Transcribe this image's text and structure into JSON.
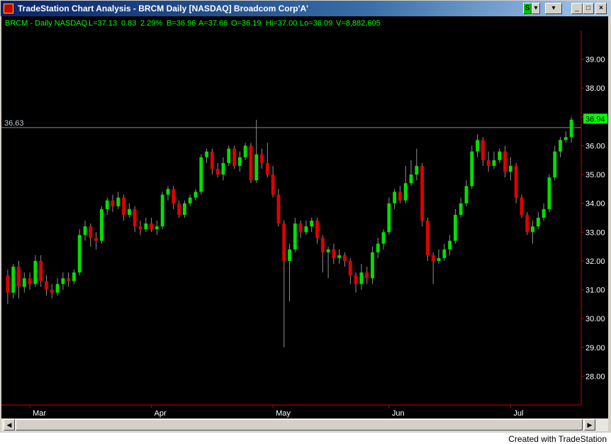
{
  "window": {
    "title": "TradeStation Chart Analysis - BRCM Daily [NASDAQ] Broadcom Corp'A'",
    "symbol_button": "S",
    "min_glyph": "_",
    "max_glyph": "□",
    "close_glyph": "×",
    "dropdown_glyph": "▾"
  },
  "status": {
    "symbol": "BRCM - Daily  NASDAQ",
    "last": "L=37.13",
    "change": "0.83",
    "pct": "2.29%",
    "bid": "B=36.96",
    "ask": "A=37.66",
    "open": "O=36.19",
    "high": "Hi=37.00",
    "low": "Lo=36.09",
    "volume": "V=8,882,605"
  },
  "colors": {
    "up": "#00e000",
    "down": "#e00000",
    "background": "#000000",
    "axis": "#cc0000",
    "status_text": "#00ff00",
    "hline": "#8090a0",
    "last_box": "#00ff00"
  },
  "scroll": {
    "left_arrow": "◀",
    "right_arrow": "▶"
  },
  "footer": "Created with TradeStation",
  "chart_data": {
    "type": "candlestick",
    "y_range": [
      27.0,
      40.0
    ],
    "y_ticks": [
      28.0,
      29.0,
      30.0,
      31.0,
      32.0,
      33.0,
      34.0,
      35.0,
      36.0,
      37.0,
      38.0,
      39.0
    ],
    "x_labels": [
      {
        "label": "Mar",
        "index": 4
      },
      {
        "label": "Apr",
        "index": 26
      },
      {
        "label": "May",
        "index": 48
      },
      {
        "label": "Jun",
        "index": 69
      },
      {
        "label": "Jul",
        "index": 91
      }
    ],
    "horizontal_line": 36.63,
    "last_price": 36.94,
    "candles": [
      [
        31.5,
        30.9,
        31.7,
        30.5
      ],
      [
        30.9,
        31.8,
        31.9,
        30.7
      ],
      [
        31.8,
        31.1,
        32.0,
        30.7
      ],
      [
        31.1,
        31.4,
        31.6,
        30.9
      ],
      [
        31.4,
        31.2,
        31.6,
        31.0
      ],
      [
        31.2,
        32.0,
        32.2,
        31.1
      ],
      [
        32.0,
        31.3,
        32.2,
        31.1
      ],
      [
        31.3,
        31.0,
        31.5,
        30.8
      ],
      [
        31.0,
        30.9,
        31.2,
        30.7
      ],
      [
        30.9,
        31.2,
        31.4,
        30.8
      ],
      [
        31.2,
        31.4,
        31.6,
        31.0
      ],
      [
        31.4,
        31.3,
        31.6,
        31.1
      ],
      [
        31.3,
        31.6,
        31.7,
        31.2
      ],
      [
        31.6,
        32.9,
        33.1,
        31.5
      ],
      [
        32.9,
        33.2,
        33.4,
        32.7
      ],
      [
        33.2,
        32.8,
        33.3,
        32.5
      ],
      [
        32.8,
        32.7,
        33.0,
        32.4
      ],
      [
        32.7,
        33.8,
        33.9,
        32.6
      ],
      [
        33.8,
        34.1,
        34.2,
        33.6
      ],
      [
        34.1,
        33.9,
        34.3,
        33.7
      ],
      [
        33.9,
        34.2,
        34.4,
        33.8
      ],
      [
        34.2,
        33.6,
        34.3,
        33.4
      ],
      [
        33.6,
        33.8,
        34.0,
        33.5
      ],
      [
        33.8,
        33.2,
        33.9,
        33.0
      ],
      [
        33.2,
        33.1,
        33.4,
        32.9
      ],
      [
        33.1,
        33.3,
        33.5,
        33.0
      ],
      [
        33.3,
        33.1,
        33.5,
        33.0
      ],
      [
        33.1,
        33.2,
        33.4,
        32.9
      ],
      [
        33.2,
        34.3,
        34.4,
        33.1
      ],
      [
        34.3,
        34.5,
        34.6,
        34.1
      ],
      [
        34.5,
        34.0,
        34.6,
        33.8
      ],
      [
        34.0,
        33.6,
        34.1,
        33.5
      ],
      [
        33.6,
        34.0,
        34.1,
        33.5
      ],
      [
        34.0,
        34.2,
        34.3,
        33.9
      ],
      [
        34.2,
        34.4,
        34.5,
        34.1
      ],
      [
        34.4,
        35.6,
        35.7,
        34.3
      ],
      [
        35.6,
        35.8,
        35.9,
        35.4
      ],
      [
        35.8,
        35.2,
        35.9,
        35.0
      ],
      [
        35.2,
        35.0,
        35.4,
        34.9
      ],
      [
        35.0,
        35.4,
        35.6,
        34.8
      ],
      [
        35.4,
        35.9,
        36.0,
        35.3
      ],
      [
        35.9,
        35.3,
        36.0,
        35.2
      ],
      [
        35.3,
        35.6,
        35.8,
        35.1
      ],
      [
        35.6,
        36.0,
        36.1,
        35.5
      ],
      [
        36.0,
        34.8,
        36.1,
        34.7
      ],
      [
        34.8,
        35.7,
        36.9,
        34.7
      ],
      [
        35.7,
        35.4,
        35.9,
        35.2
      ],
      [
        35.4,
        35.0,
        36.1,
        34.9
      ],
      [
        35.0,
        34.3,
        35.3,
        34.2
      ],
      [
        34.3,
        33.3,
        34.5,
        33.2
      ],
      [
        33.3,
        32.0,
        33.4,
        29.0
      ],
      [
        32.0,
        32.4,
        32.6,
        30.6
      ],
      [
        32.4,
        33.3,
        33.5,
        32.3
      ],
      [
        33.3,
        33.0,
        33.4,
        32.8
      ],
      [
        33.0,
        33.2,
        33.4,
        32.9
      ],
      [
        33.2,
        33.4,
        33.5,
        33.0
      ],
      [
        33.4,
        32.8,
        33.5,
        32.6
      ],
      [
        32.8,
        32.3,
        32.9,
        31.6
      ],
      [
        32.3,
        32.4,
        32.5,
        31.4
      ],
      [
        32.4,
        32.1,
        32.6,
        31.9
      ],
      [
        32.1,
        32.2,
        32.4,
        31.9
      ],
      [
        32.2,
        32.0,
        32.3,
        31.8
      ],
      [
        32.0,
        31.5,
        32.1,
        31.2
      ],
      [
        31.5,
        31.2,
        31.6,
        30.9
      ],
      [
        31.2,
        31.6,
        31.9,
        31.0
      ],
      [
        31.6,
        31.4,
        31.8,
        31.2
      ],
      [
        31.4,
        32.3,
        32.5,
        31.2
      ],
      [
        32.3,
        32.6,
        32.8,
        32.1
      ],
      [
        32.6,
        33.0,
        33.1,
        32.4
      ],
      [
        33.0,
        34.0,
        34.2,
        32.9
      ],
      [
        34.0,
        34.4,
        34.5,
        33.8
      ],
      [
        34.4,
        34.1,
        34.6,
        34.0
      ],
      [
        34.1,
        34.7,
        35.3,
        34.0
      ],
      [
        34.7,
        35.0,
        35.5,
        34.6
      ],
      [
        35.0,
        35.3,
        35.9,
        34.8
      ],
      [
        35.3,
        33.4,
        35.4,
        33.2
      ],
      [
        33.4,
        32.2,
        33.5,
        32.0
      ],
      [
        32.2,
        32.0,
        32.3,
        31.2
      ],
      [
        32.0,
        32.1,
        32.4,
        31.9
      ],
      [
        32.1,
        32.4,
        32.6,
        32.0
      ],
      [
        32.4,
        32.7,
        32.9,
        32.2
      ],
      [
        32.7,
        33.6,
        33.8,
        32.6
      ],
      [
        33.6,
        34.0,
        34.2,
        33.5
      ],
      [
        34.0,
        34.6,
        34.8,
        33.9
      ],
      [
        34.6,
        35.8,
        36.0,
        34.5
      ],
      [
        35.8,
        36.2,
        36.4,
        35.6
      ],
      [
        36.2,
        35.5,
        36.3,
        35.3
      ],
      [
        35.5,
        35.3,
        35.8,
        35.1
      ],
      [
        35.3,
        35.5,
        35.8,
        35.2
      ],
      [
        35.5,
        35.8,
        35.9,
        35.4
      ],
      [
        35.8,
        35.1,
        36.0,
        34.9
      ],
      [
        35.1,
        35.3,
        35.6,
        34.8
      ],
      [
        35.3,
        34.2,
        35.4,
        34.0
      ],
      [
        34.2,
        33.6,
        34.3,
        33.5
      ],
      [
        33.6,
        33.0,
        33.7,
        32.9
      ],
      [
        33.0,
        33.2,
        33.4,
        32.6
      ],
      [
        33.2,
        33.5,
        33.7,
        33.1
      ],
      [
        33.5,
        33.8,
        34.0,
        33.4
      ],
      [
        33.8,
        34.9,
        35.0,
        33.7
      ],
      [
        34.9,
        35.8,
        36.0,
        34.8
      ],
      [
        35.8,
        36.2,
        36.3,
        35.6
      ],
      [
        36.2,
        36.3,
        36.5,
        36.1
      ],
      [
        36.3,
        36.9,
        37.0,
        36.1
      ]
    ]
  }
}
